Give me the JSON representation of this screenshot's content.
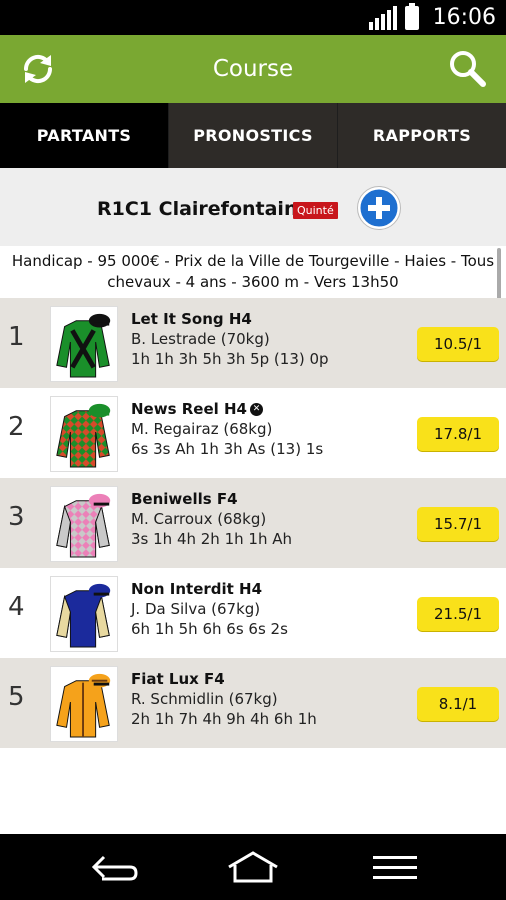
{
  "status_bar": {
    "time": "16:06"
  },
  "app_bar": {
    "title": "Course"
  },
  "tabs": [
    {
      "label": "PARTANTS",
      "active": true
    },
    {
      "label": "PRONOSTICS",
      "active": false
    },
    {
      "label": "RAPPORTS",
      "active": false
    }
  ],
  "race": {
    "title": "R1C1 Clairefontaine",
    "badge": "Quinté",
    "description_line1": "Handicap - 95 000€ - Prix de la Ville de Tourgeville - Haies - Tous",
    "description_line2": "chevaux - 4 ans - 3600 m - Vers 13h50"
  },
  "runners": [
    {
      "number": "1",
      "name": "Let It Song H4",
      "jockey": "B. Lestrade (70kg)",
      "form": "1h 1h 3h 5h 3h 5p (13) 0p",
      "odds": "10.5/1"
    },
    {
      "number": "2",
      "name": "News Reel H4",
      "jockey": "M. Regairaz (68kg)",
      "form": "6s 3s Ah 1h 3h As (13) 1s",
      "odds": "17.8/1"
    },
    {
      "number": "3",
      "name": "Beniwells F4",
      "jockey": "M. Carroux (68kg)",
      "form": "3s 1h 4h 2h 1h 1h Ah",
      "odds": "15.7/1"
    },
    {
      "number": "4",
      "name": "Non Interdit H4",
      "jockey": "J. Da Silva (67kg)",
      "form": "6h 1h 5h 6h 6s 6s 2s",
      "odds": "21.5/1"
    },
    {
      "number": "5",
      "name": "Fiat Lux F4",
      "jockey": "R. Schmidlin (67kg)",
      "form": "2h 1h 7h 4h 9h 4h 6h 1h",
      "odds": "8.1/1"
    }
  ],
  "colors": {
    "app_bar": "#7aa832",
    "odds_badge": "#f9e11a",
    "quinte_badge": "#c8161c",
    "row_alt": "#e5e2dd"
  }
}
